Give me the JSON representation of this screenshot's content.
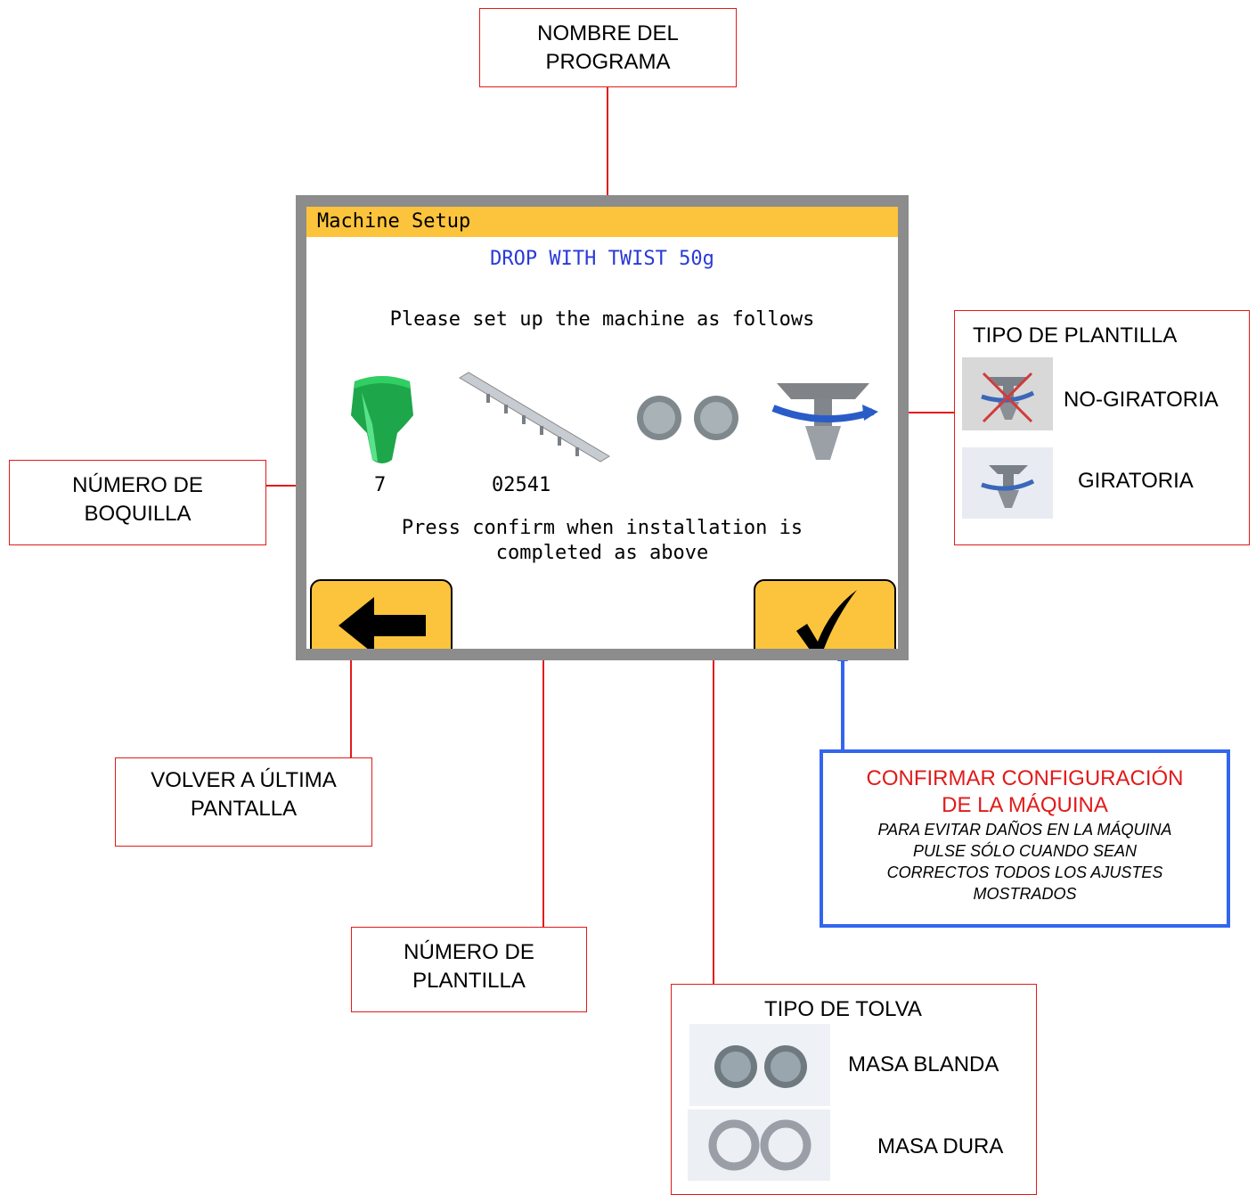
{
  "screen": {
    "window_title": "Machine Setup",
    "program_name": "DROP WITH TWIST 50g",
    "instruction": "Please set up the machine as follows",
    "nozzle_number": "7",
    "template_number": "02541",
    "confirm_text_line1": "Press confirm when installation is",
    "confirm_text_line2": "completed as above",
    "icons": [
      "nozzle-icon",
      "template-icon",
      "hopper-gears-icon",
      "twist-template-icon"
    ],
    "back_button_icon": "arrow-left-icon",
    "confirm_button_icon": "checkmark-icon"
  },
  "callouts": {
    "program_name": [
      "NOMBRE DEL",
      "PROGRAMA"
    ],
    "nozzle_number": [
      "NÚMERO DE",
      "BOQUILLA"
    ],
    "template_type": {
      "title": "TIPO DE PLANTILLA",
      "option1": "NO-GIRATORIA",
      "option2": "GIRATORIA"
    },
    "back": [
      "VOLVER A ÚLTIMA",
      "PANTALLA"
    ],
    "confirm": {
      "title1": "CONFIRMAR CONFIGURACIÓN",
      "title2": "DE LA MÁQUINA",
      "note1": "PARA EVITAR DAÑOS EN LA MÁQUINA",
      "note2": "PULSE SÓLO CUANDO SEAN",
      "note3": "CORRECTOS TODOS LOS AJUSTES",
      "note4": "MOSTRADOS"
    },
    "template_number": [
      "NÚMERO DE",
      "PLANTILLA"
    ],
    "hopper_type": {
      "title": "TIPO DE TOLVA",
      "option1": "MASA BLANDA",
      "option2": "MASA DURA"
    }
  },
  "colors": {
    "accent_yellow": "#fcc43c",
    "program_name_blue": "#2a3ad8",
    "callout_red": "#e21a1a",
    "confirm_border_blue": "#3366ee",
    "screen_frame": "#8c8c8c"
  }
}
